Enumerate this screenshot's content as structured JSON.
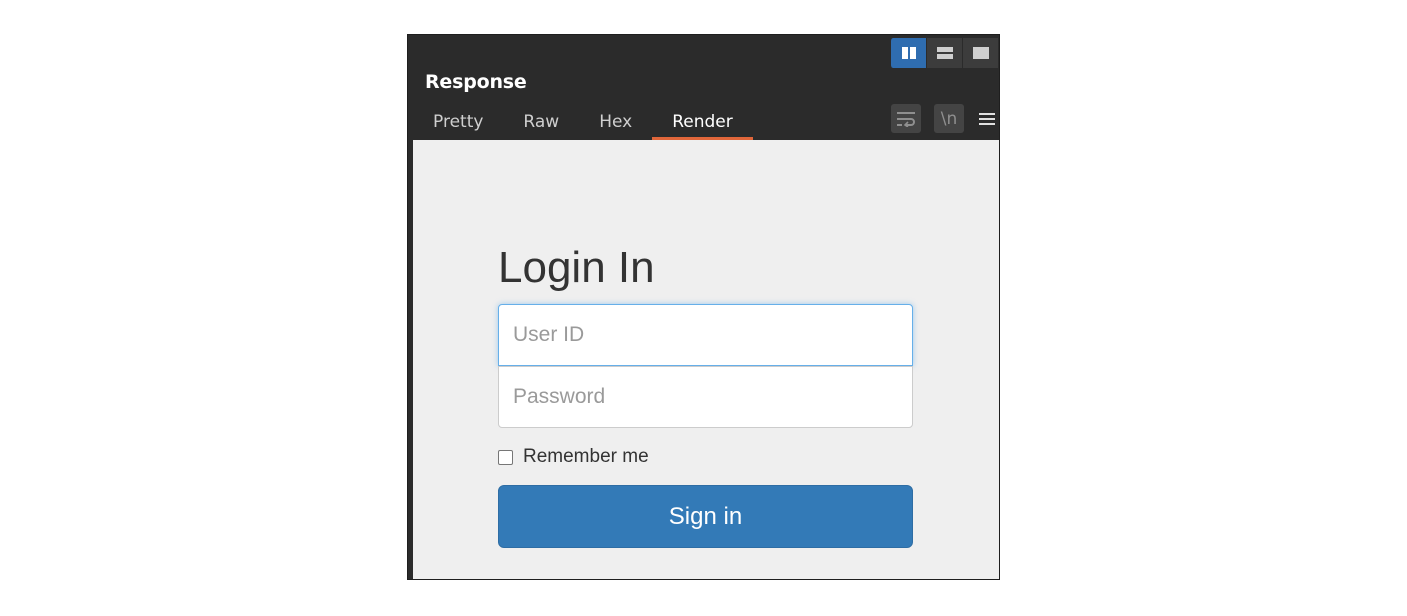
{
  "panel": {
    "title": "Response",
    "tabs": [
      {
        "label": "Pretty",
        "active": false
      },
      {
        "label": "Raw",
        "active": false
      },
      {
        "label": "Hex",
        "active": false
      },
      {
        "label": "Render",
        "active": true
      }
    ],
    "layout_toggles": [
      "split-vertical-icon",
      "split-horizontal-icon",
      "single-pane-icon"
    ],
    "tools": {
      "newline_label": "\\n"
    },
    "colors": {
      "panel_bg": "#2b2b2b",
      "active_toggle": "#2f6db0",
      "active_tab_underline": "#e0663a"
    }
  },
  "login": {
    "title": "Login In",
    "user_placeholder": "User ID",
    "password_placeholder": "Password",
    "remember_label": "Remember me",
    "signin_label": "Sign in",
    "colors": {
      "button": "#337ab7",
      "render_bg": "#efefef"
    }
  }
}
